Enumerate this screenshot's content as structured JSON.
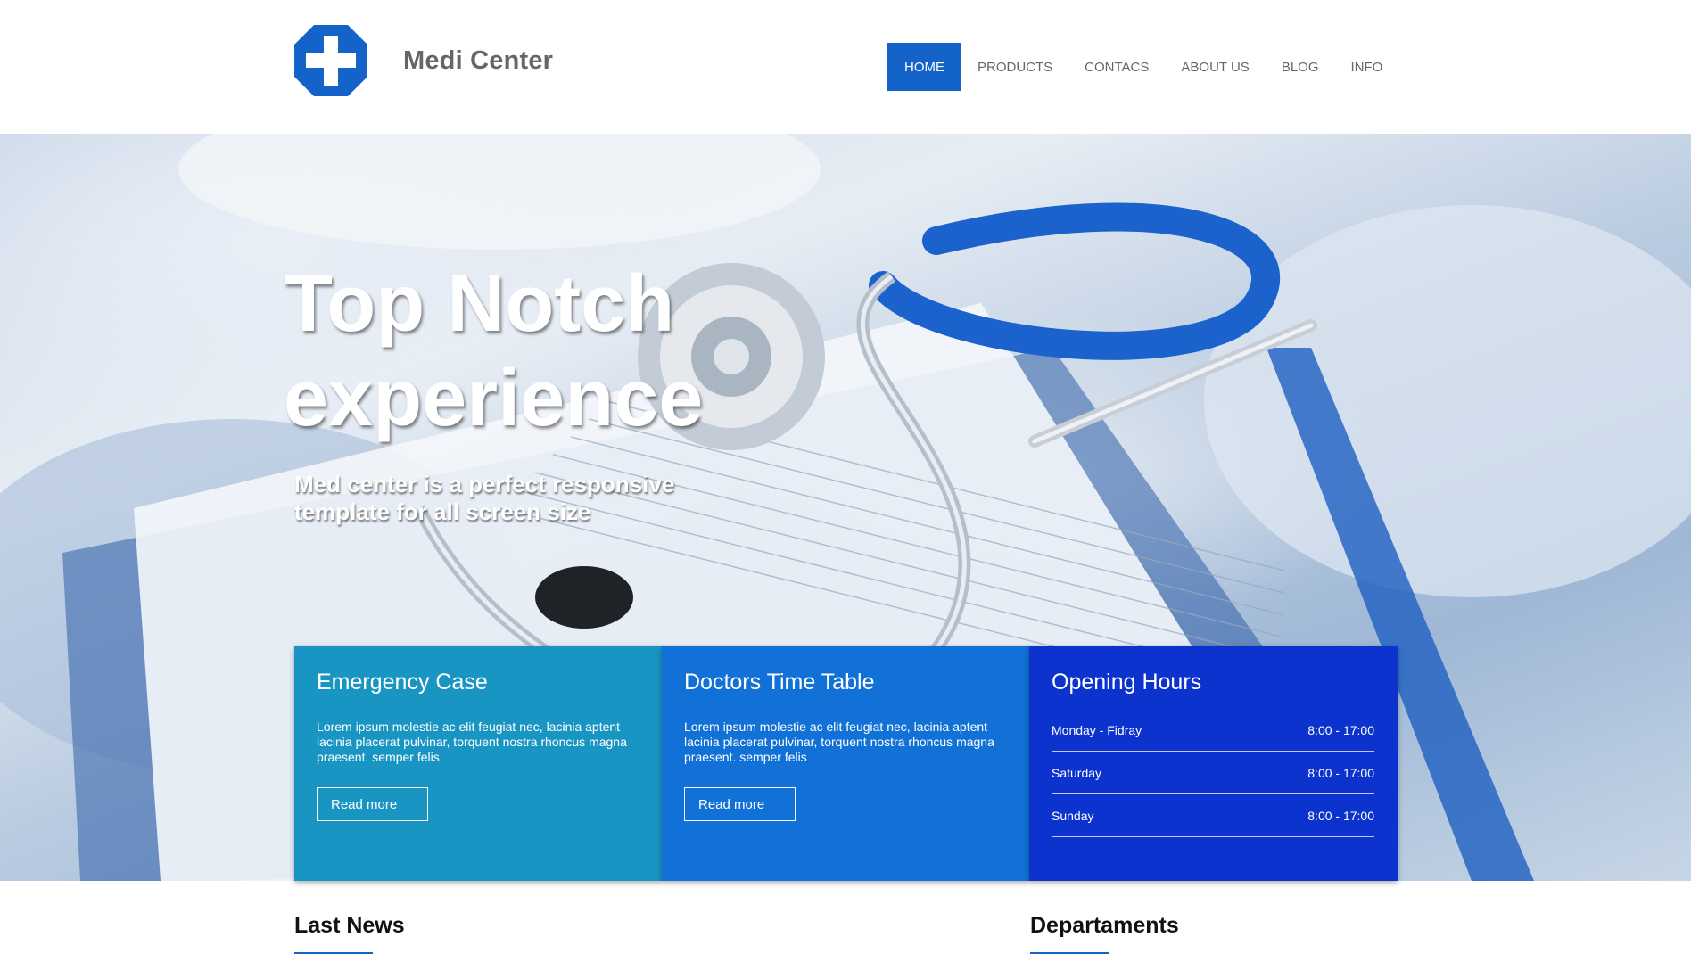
{
  "header": {
    "brand": "Medi Center",
    "nav": [
      {
        "label": "HOME",
        "active": true
      },
      {
        "label": "PRODUCTS",
        "active": false
      },
      {
        "label": "CONTACS",
        "active": false
      },
      {
        "label": "ABOUT US",
        "active": false
      },
      {
        "label": "BLOG",
        "active": false
      },
      {
        "label": "INFO",
        "active": false
      }
    ]
  },
  "hero": {
    "title_line1": "Top Notch",
    "title_line2": "experience",
    "subtitle": "Med center is a perfect responsive template for all screen size"
  },
  "boxes": {
    "emergency": {
      "title": "Emergency Case",
      "text": "Lorem ipsum molestie ac elit feugiat nec, lacinia aptent lacinia placerat pulvinar, torquent nostra rhoncus magna praesent. semper felis",
      "button": "Read more"
    },
    "timetable": {
      "title": "Doctors Time Table",
      "text": "Lorem ipsum molestie ac elit feugiat nec, lacinia aptent lacinia placerat pulvinar, torquent nostra rhoncus magna praesent. semper felis",
      "button": "Read more"
    },
    "hours": {
      "title": "Opening Hours",
      "rows": [
        {
          "day": "Monday - Fidray",
          "time": "8:00 - 17:00"
        },
        {
          "day": "Saturday",
          "time": "8:00 - 17:00"
        },
        {
          "day": "Sunday",
          "time": "8:00 - 17:00"
        }
      ]
    }
  },
  "sections": {
    "news": "Last News",
    "departments": "Departaments"
  },
  "colors": {
    "accent": "#1463c9",
    "box_emergency": "#1995c4",
    "box_timetable": "#1171d6",
    "box_hours": "#0d33cf"
  },
  "icons": {
    "logo": "medical-cross-icon"
  }
}
